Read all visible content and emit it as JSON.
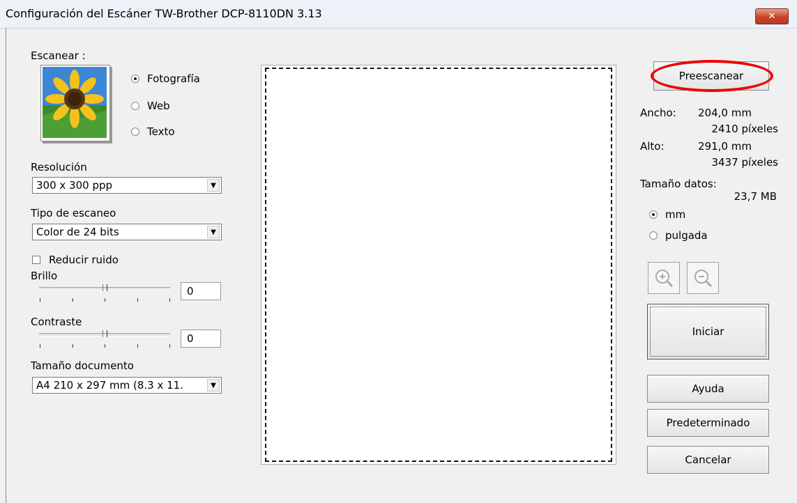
{
  "window": {
    "title": "Configuración del Escáner TW-Brother DCP-8110DN   3.13",
    "close_glyph": "✕"
  },
  "scan_type": {
    "label": "Escanear :",
    "options": [
      {
        "label": "Fotografía",
        "selected": true
      },
      {
        "label": "Web",
        "selected": false
      },
      {
        "label": "Texto",
        "selected": false
      }
    ]
  },
  "resolution": {
    "label": "Resolución",
    "value": "300 x 300 ppp"
  },
  "scan_mode": {
    "label": "Tipo de escaneo",
    "value": "Color de 24 bits"
  },
  "noise": {
    "label": "Reducir ruido",
    "checked": false
  },
  "brightness": {
    "label": "Brillo",
    "value": "0",
    "slider_fraction": 0.5
  },
  "contrast": {
    "label": "Contraste",
    "value": "0",
    "slider_fraction": 0.5
  },
  "doc_size": {
    "label": "Tamaño documento",
    "value": "A4 210 x 297 mm (8.3 x 11."
  },
  "prescan_button": "Preescanear",
  "dimensions": {
    "width_label": "Ancho:",
    "width_mm": "204,0 mm",
    "width_px": "2410 píxeles",
    "height_label": "Alto:",
    "height_mm": "291,0 mm",
    "height_px": "3437 píxeles",
    "size_label": "Tamaño datos:",
    "size_value": "23,7 MB"
  },
  "units": {
    "options": [
      {
        "label": "mm",
        "selected": true
      },
      {
        "label": "pulgada",
        "selected": false
      }
    ]
  },
  "buttons": {
    "start": "Iniciar",
    "help": "Ayuda",
    "default": "Predeterminado",
    "cancel": "Cancelar"
  },
  "colors": {
    "highlight": "#e00000",
    "title_bg": "#eef2f8",
    "close_red": "#c8442a"
  }
}
